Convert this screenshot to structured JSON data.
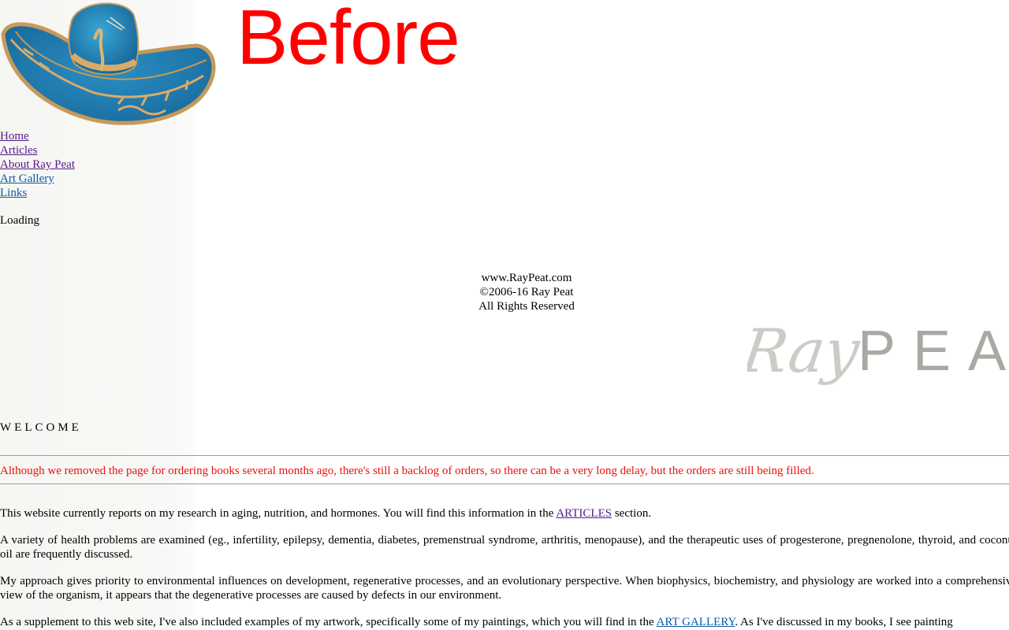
{
  "overlay_label": "Before",
  "nav": {
    "items": [
      {
        "label": "Home"
      },
      {
        "label": "Articles"
      },
      {
        "label": "About Ray Peat"
      },
      {
        "label": "Art Gallery"
      },
      {
        "label": "Links"
      }
    ]
  },
  "loading_text": "Loading",
  "footer": {
    "site": "www.RayPeat.com",
    "copyright": "©2006-16 Ray Peat",
    "rights": "All Rights Reserved"
  },
  "logo": {
    "script_part": "Ray",
    "caps_part": "PEA"
  },
  "welcome_heading": "WELCOME",
  "notice": "Although we removed the page for ordering books several months ago, there's still a backlog of orders, so there can be a very long delay, but the orders are still being filled.",
  "paragraphs": {
    "p1_before": "This website currently reports on my research in aging, nutrition, and hormones. You will find this information in the ",
    "p1_link": "ARTICLES",
    "p1_after": " section.",
    "p2": "A variety of health problems are examined (eg., infertility, epilepsy, dementia, diabetes, premenstrual syndrome, arthritis, menopause), and the therapeutic uses of progesterone, pregnenolone, thyroid, and coconut oil are frequently discussed.",
    "p3": "My approach gives priority to environmental influences on development, regenerative processes, and an evolutionary perspective. When biophysics, biochemistry, and physiology are worked into a comprehensive view of the organism, it appears that the degenerative processes are caused by defects in our environment.",
    "p4_before": "As a supplement to this web site, I've also included examples of my artwork, specifically some of my paintings, which you will find in the ",
    "p4_link": "ART GALLERY",
    "p4_after": ". As I've discussed in my books, I see painting"
  },
  "colors": {
    "notice": "#e8100a",
    "overlay": "#ff0000",
    "visited_link": "#551a8b",
    "link": "#0a5aa8"
  }
}
